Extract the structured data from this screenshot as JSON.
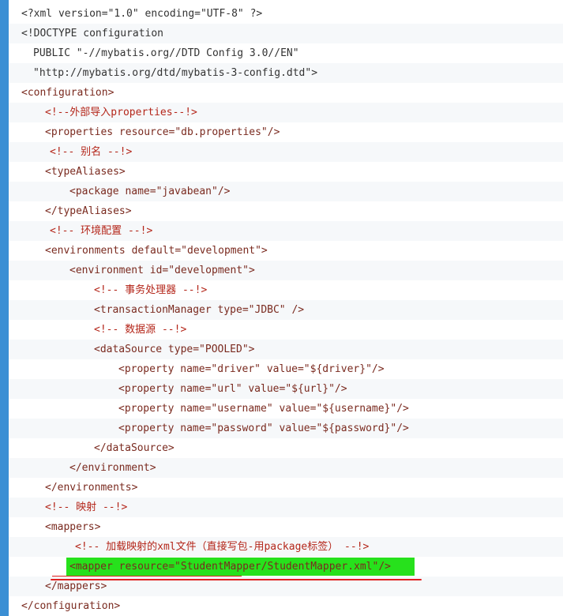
{
  "lines": [
    "<?xml version=\"1.0\" encoding=\"UTF-8\" ?>",
    "<!DOCTYPE configuration",
    "PUBLIC \"-//mybatis.org//DTD Config 3.0//EN\"",
    "\"http://mybatis.org/dtd/mybatis-3-config.dtd\">",
    "<configuration>",
    "<!--外部导入properties--!>",
    "<properties resource=\"db.properties\"/>",
    "<!-- 别名 --!>",
    "<typeAliases>",
    "<package name=\"javabean\"/>",
    "</typeAliases>",
    "<!-- 环境配置 --!>",
    "<environments default=\"development\">",
    "<environment id=\"development\">",
    "<!-- 事务处理器 --!>",
    "<transactionManager type=\"JDBC\" />",
    "<!-- 数据源 --!>",
    "<dataSource type=\"POOLED\">",
    "<property name=\"driver\" value=\"${driver}\"/>",
    "<property name=\"url\" value=\"${url}\"/>",
    "<property name=\"username\" value=\"${username}\"/>",
    "<property name=\"password\" value=\"${password}\"/>",
    "</dataSource>",
    "</environment>",
    "</environments>",
    "<!-- 映射 --!>",
    "<mappers>",
    "<!-- 加载映射的xml文件（直接写包-用package标签） --!>",
    "<mapper resource=\"StudentMapper/StudentMapper.xml\"/>",
    "</mappers>",
    "</configuration>"
  ],
  "colors": {
    "gutter": "#3b8fd4",
    "highlight": "#27e11c",
    "underline": "#e02020",
    "comment": "#b4261a"
  }
}
